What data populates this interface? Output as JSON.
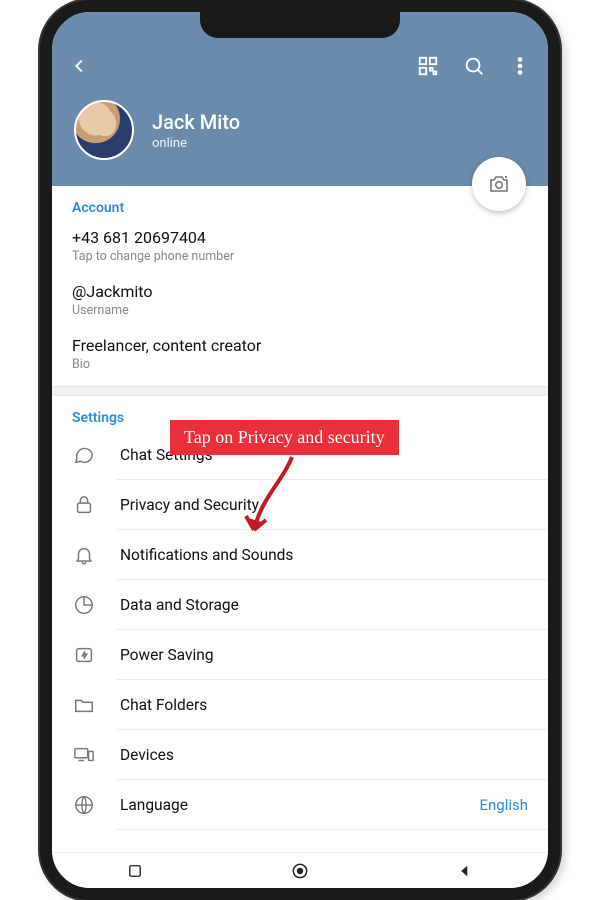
{
  "annotation": {
    "text": "Tap on Privacy and security"
  },
  "header": {
    "name": "Jack Mito",
    "status": "online"
  },
  "account": {
    "section_label": "Account",
    "phone": {
      "value": "+43 681 20697404",
      "hint": "Tap to change phone number"
    },
    "username": {
      "value": "@Jackmito",
      "hint": "Username"
    },
    "bio": {
      "value": "Freelancer, content creator",
      "hint": "Bio"
    }
  },
  "settings": {
    "section_label": "Settings",
    "items": [
      {
        "icon": "chat",
        "label": "Chat Settings",
        "value": ""
      },
      {
        "icon": "lock",
        "label": "Privacy and Security",
        "value": ""
      },
      {
        "icon": "bell",
        "label": "Notifications and Sounds",
        "value": ""
      },
      {
        "icon": "pie",
        "label": "Data and Storage",
        "value": ""
      },
      {
        "icon": "bolt",
        "label": "Power Saving",
        "value": ""
      },
      {
        "icon": "folder",
        "label": "Chat Folders",
        "value": ""
      },
      {
        "icon": "devices",
        "label": "Devices",
        "value": ""
      },
      {
        "icon": "globe",
        "label": "Language",
        "value": "English"
      }
    ]
  }
}
